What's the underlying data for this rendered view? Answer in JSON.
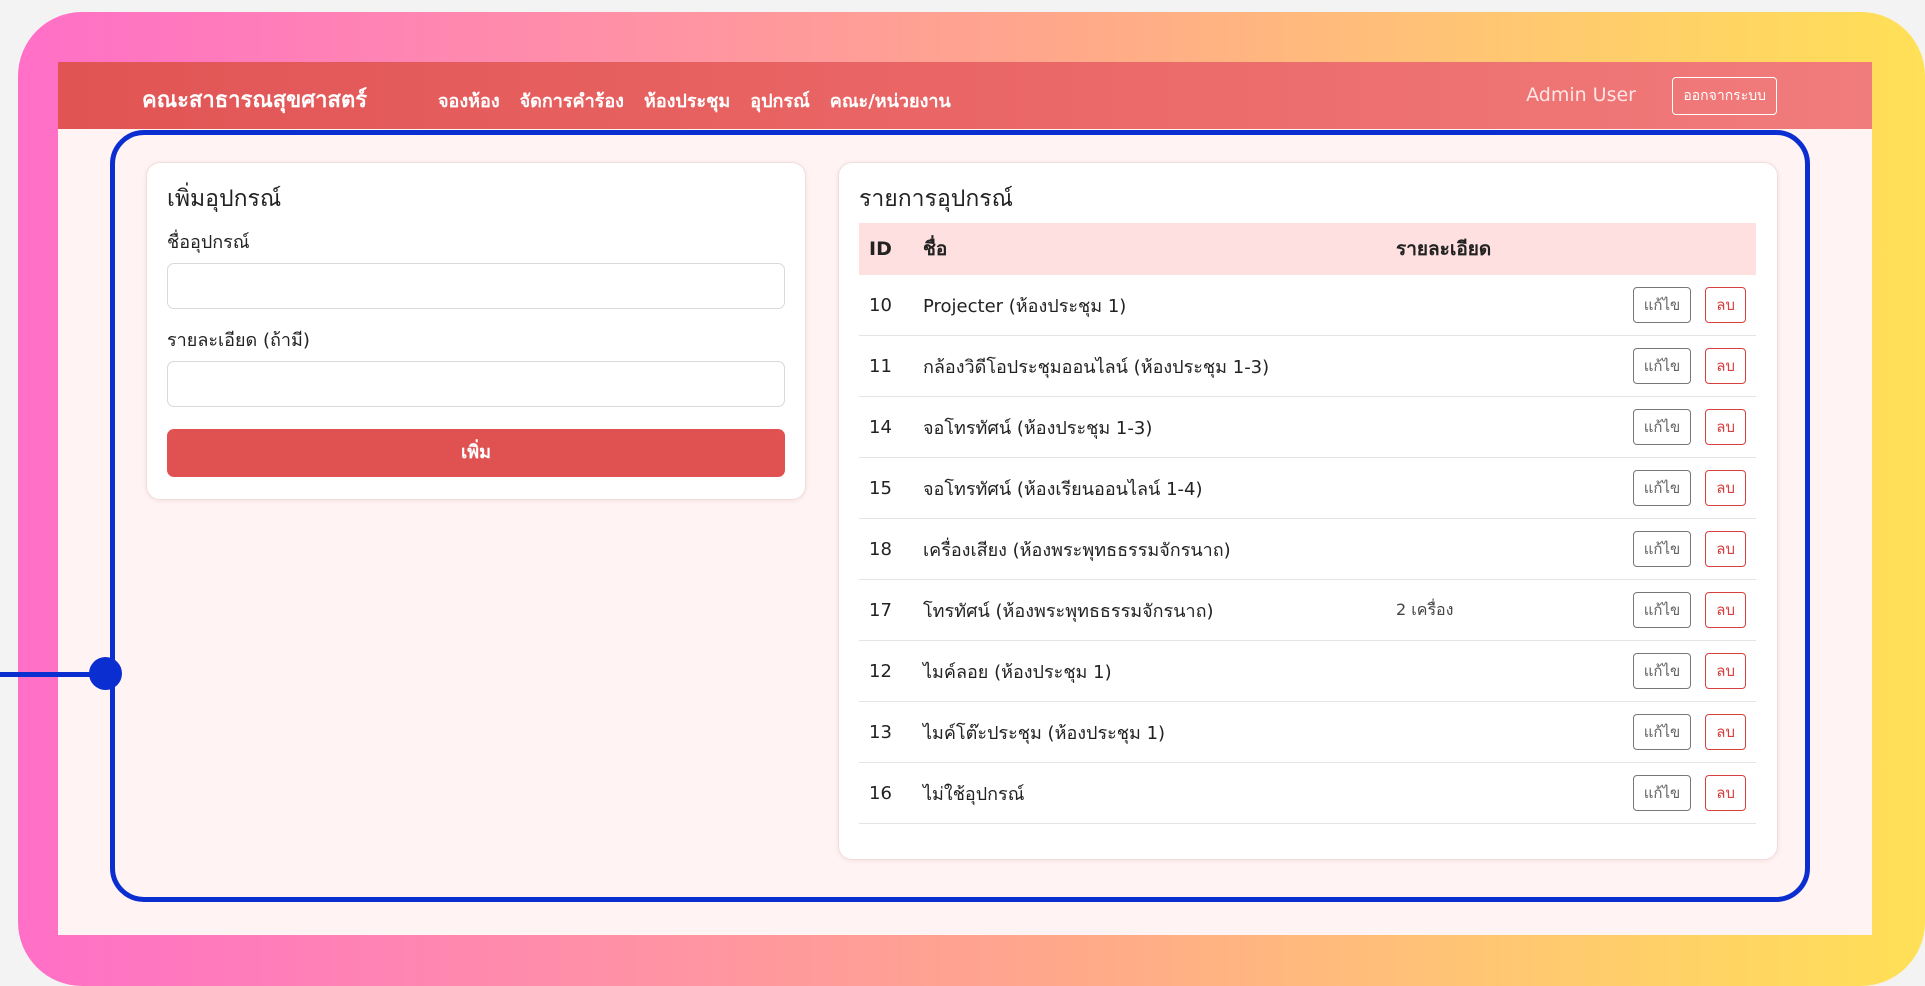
{
  "navbar": {
    "brand": "คณะสาธารณสุขศาสตร์",
    "links": [
      "จองห้อง",
      "จัดการคำร้อง",
      "ห้องประชุม",
      "อุปกรณ์",
      "คณะ/หน่วยงาน"
    ],
    "user": "Admin User",
    "logout": "ออกจากระบบ"
  },
  "add_form": {
    "title": "เพิ่มอุปกรณ์",
    "name_label": "ชื่ออุปกรณ์",
    "name_value": "",
    "detail_label": "รายละเอียด (ถ้ามี)",
    "detail_value": "",
    "submit": "เพิ่ม"
  },
  "list": {
    "title": "รายการอุปกรณ์",
    "headers": {
      "id": "ID",
      "name": "ชื่อ",
      "detail": "รายละเอียด"
    },
    "edit_label": "แก้ไข",
    "delete_label": "ลบ",
    "rows": [
      {
        "id": "10",
        "name": "Projecter (ห้องประชุม 1)",
        "detail": ""
      },
      {
        "id": "11",
        "name": "กล้องวิดีโอประชุมออนไลน์ (ห้องประชุม 1-3)",
        "detail": ""
      },
      {
        "id": "14",
        "name": "จอโทรทัศน์ (ห้องประชุม 1-3)",
        "detail": ""
      },
      {
        "id": "15",
        "name": "จอโทรทัศน์ (ห้องเรียนออนไลน์ 1-4)",
        "detail": ""
      },
      {
        "id": "18",
        "name": "เครื่องเสียง (ห้องพระพุทธธรรมจักรนาถ)",
        "detail": ""
      },
      {
        "id": "17",
        "name": "โทรทัศน์ (ห้องพระพุทธธรรมจักรนาถ)",
        "detail": "2 เครื่อง"
      },
      {
        "id": "12",
        "name": "ไมค์ลอย (ห้องประชุม 1)",
        "detail": ""
      },
      {
        "id": "13",
        "name": "ไมค์โต๊ะประชุม (ห้องประชุม 1)",
        "detail": ""
      },
      {
        "id": "16",
        "name": "ไม่ใช้อุปกรณ์",
        "detail": ""
      }
    ]
  },
  "colors": {
    "accent": "#e05252",
    "highlight": "#0a2ecf"
  }
}
